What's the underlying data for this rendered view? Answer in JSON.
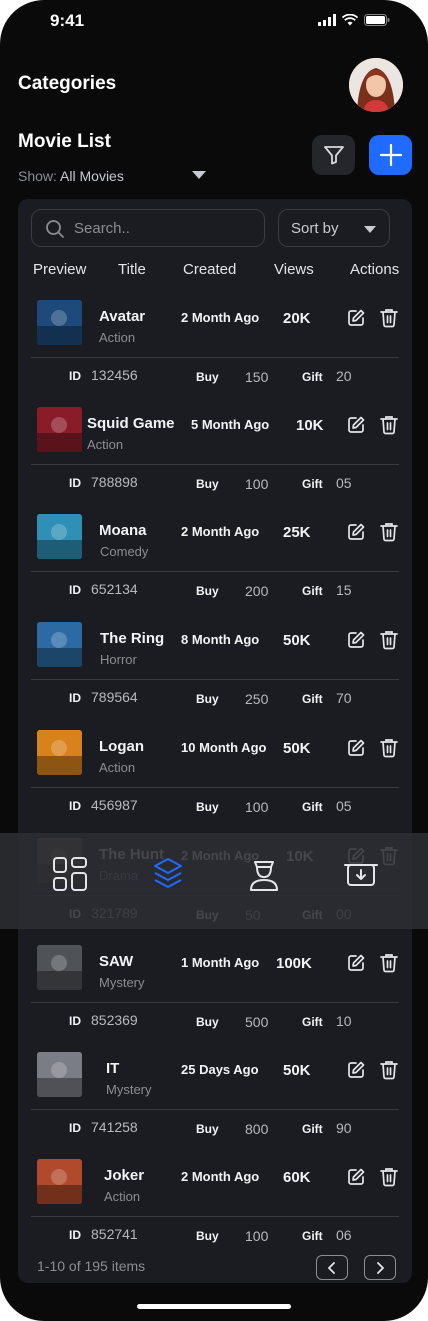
{
  "status": {
    "time": "9:41"
  },
  "header": {
    "title": "Categories"
  },
  "list": {
    "title": "Movie List",
    "show_label": "Show:",
    "show_value": "All Movies",
    "search_placeholder": "Search..",
    "sort_label": "Sort by",
    "columns": [
      "Preview",
      "Title",
      "Created",
      "Views",
      "Actions"
    ],
    "labels": {
      "id": "ID",
      "buy": "Buy",
      "gift": "Gift"
    },
    "movies": [
      {
        "title": "Avatar",
        "genre": "Action",
        "created": "2 Month Ago",
        "views": "20K",
        "id": "132456",
        "buy": "150",
        "gift": "20",
        "color": "#1d4a7a"
      },
      {
        "title": "Squid Game",
        "genre": "Action",
        "created": "5 Month Ago",
        "views": "10K",
        "id": "788898",
        "buy": "100",
        "gift": "05",
        "color": "#8a1c2a"
      },
      {
        "title": "Moana",
        "genre": "Comedy",
        "created": "2 Month Ago",
        "views": "25K",
        "id": "652134",
        "buy": "200",
        "gift": "15",
        "color": "#2f8fb5"
      },
      {
        "title": "The Ring",
        "genre": "Horror",
        "created": "8 Month Ago",
        "views": "50K",
        "id": "789564",
        "buy": "250",
        "gift": "70",
        "color": "#2c6aa3"
      },
      {
        "title": "Logan",
        "genre": "Action",
        "created": "10 Month Ago",
        "views": "50K",
        "id": "456987",
        "buy": "100",
        "gift": "05",
        "color": "#d9821c"
      },
      {
        "title": "The Hunt",
        "genre": "Drama",
        "created": "2 Month Ago",
        "views": "10K",
        "id": "321789",
        "buy": "50",
        "gift": "00",
        "color": "#5a4a3a"
      },
      {
        "title": "SAW",
        "genre": "Mystery",
        "created": "1 Month Ago",
        "views": "100K",
        "id": "852369",
        "buy": "500",
        "gift": "10",
        "color": "#4f5256"
      },
      {
        "title": "IT",
        "genre": "Mystery",
        "created": "25 Days Ago",
        "views": "50K",
        "id": "741258",
        "buy": "800",
        "gift": "90",
        "color": "#7a7d84"
      },
      {
        "title": "Joker",
        "genre": "Action",
        "created": "2 Month Ago",
        "views": "60K",
        "id": "852741",
        "buy": "100",
        "gift": "06",
        "color": "#b04a2a"
      }
    ],
    "pagination": "1-10 of 195 items"
  },
  "tabbar": {
    "active": "layers"
  },
  "colors": {
    "accent": "#1f6bff",
    "background": "#0a0a0b",
    "card": "#1b1c21"
  }
}
